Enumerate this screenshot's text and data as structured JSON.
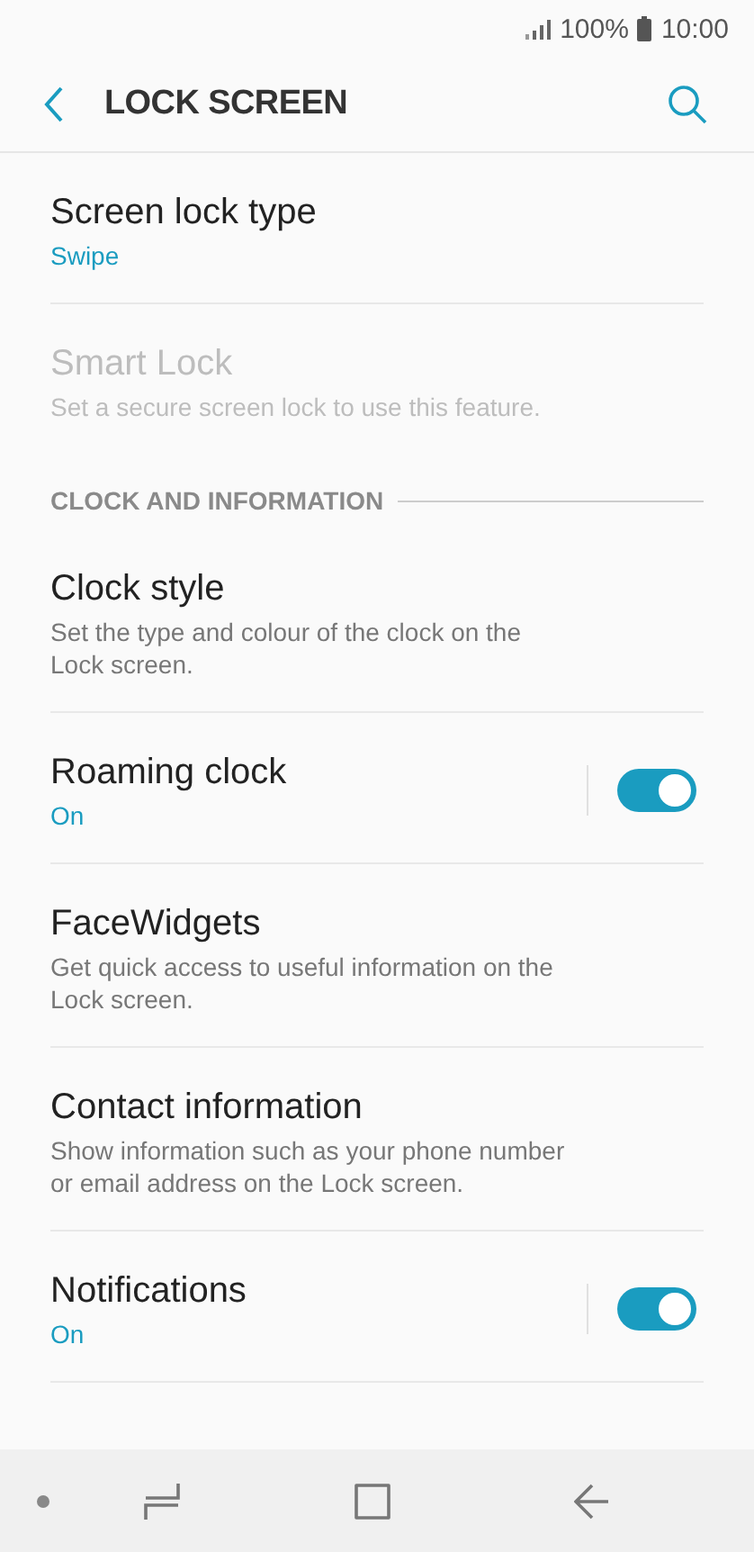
{
  "status_bar": {
    "battery": "100%",
    "time": "10:00"
  },
  "header": {
    "title": "LOCK SCREEN"
  },
  "items": [
    {
      "kind": "setting",
      "title": "Screen lock type",
      "value": "Swipe",
      "disabled": false
    },
    {
      "kind": "setting",
      "title": "Smart Lock",
      "description": "Set a secure screen lock to use this feature.",
      "disabled": true
    },
    {
      "kind": "section",
      "title": "CLOCK AND INFORMATION"
    },
    {
      "kind": "setting",
      "title": "Clock style",
      "description": "Set the type and colour of the clock on the Lock screen.",
      "disabled": false
    },
    {
      "kind": "toggle",
      "title": "Roaming clock",
      "value": "On",
      "disabled": false,
      "on": true
    },
    {
      "kind": "setting",
      "title": "FaceWidgets",
      "description": "Get quick access to useful information on the Lock screen.",
      "disabled": false
    },
    {
      "kind": "setting",
      "title": "Contact information",
      "description": "Show information such as your phone number or email address on the Lock screen.",
      "disabled": false
    },
    {
      "kind": "toggle",
      "title": "Notifications",
      "value": "On",
      "disabled": false,
      "on": true
    }
  ]
}
